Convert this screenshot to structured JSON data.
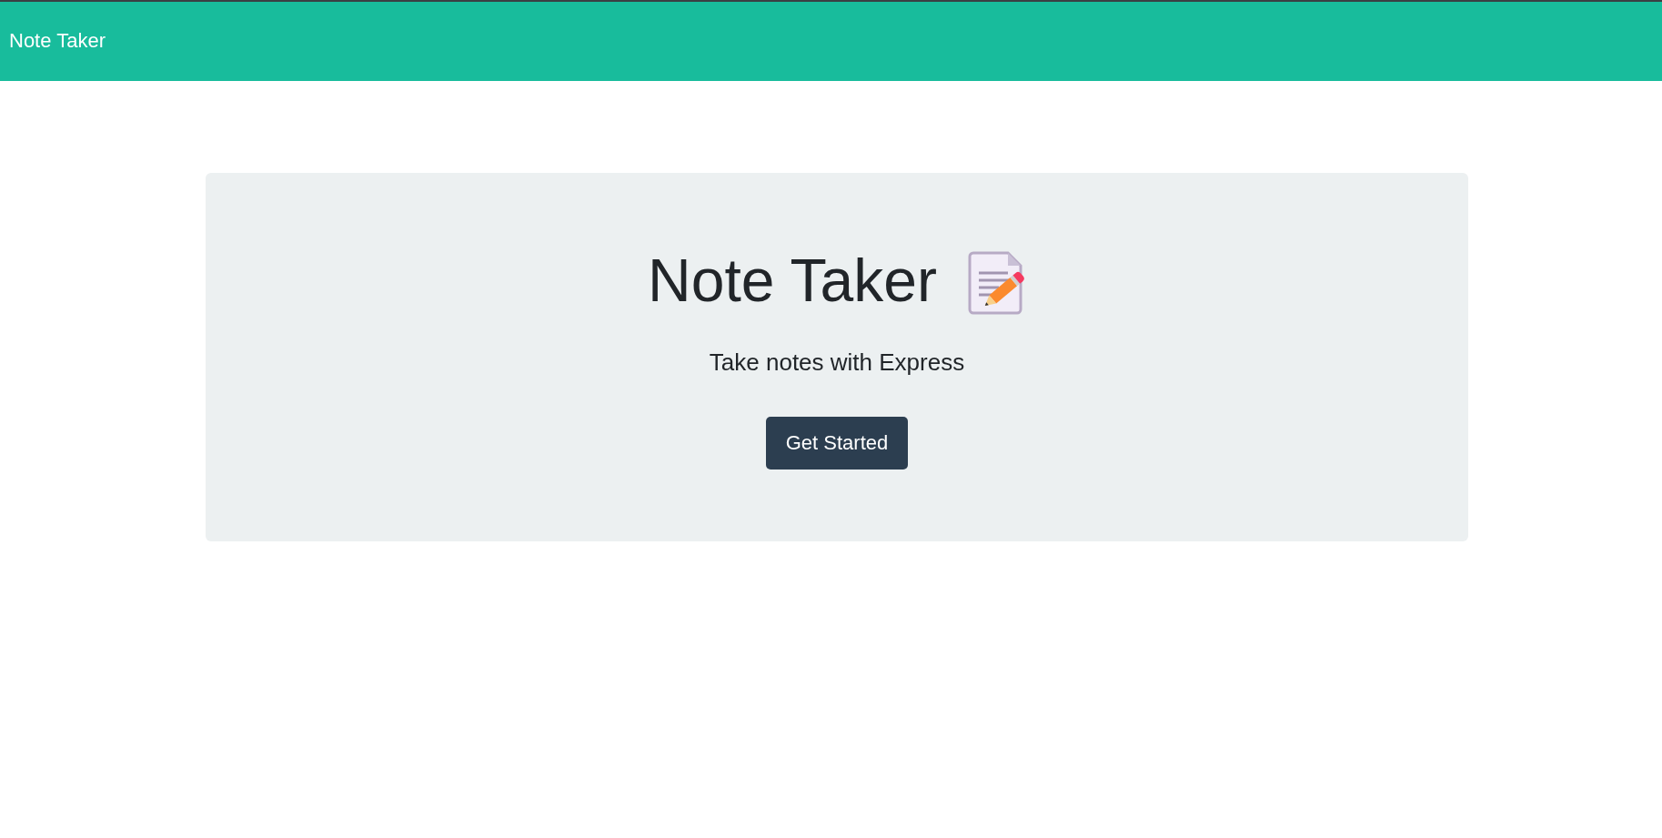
{
  "navbar": {
    "brand": "Note Taker"
  },
  "hero": {
    "title": "Note Taker",
    "subtitle": "Take notes with Express",
    "button": "Get Started"
  }
}
